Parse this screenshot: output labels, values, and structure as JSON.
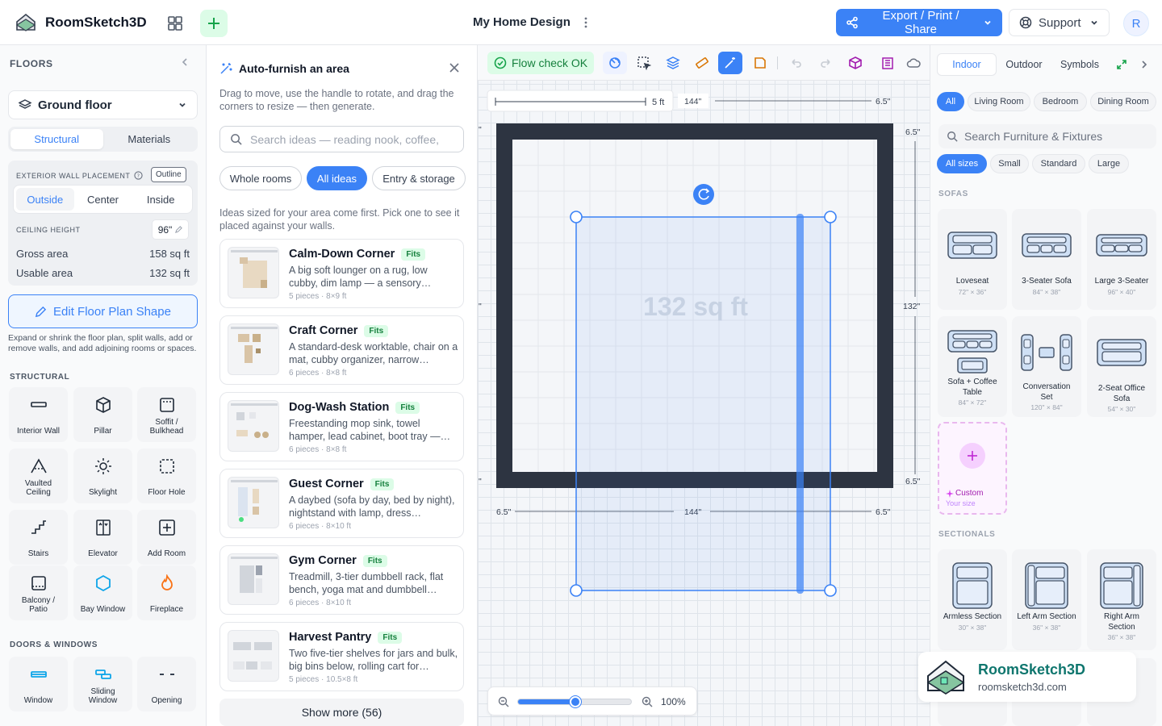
{
  "app": {
    "brand": "RoomSketch3D",
    "doc_title": "My Home Design",
    "avatar_initial": "R"
  },
  "topbar": {
    "export_label": "Export / Print / Share",
    "support_label": "Support"
  },
  "left": {
    "floors_label": "FLOORS",
    "floor_selected": "Ground floor",
    "tabs": [
      "Structural",
      "Materials"
    ],
    "wall_placement_label": "EXTERIOR WALL PLACEMENT",
    "outline_badge": "Outline",
    "placement_options": [
      "Outside",
      "Center",
      "Inside"
    ],
    "ceiling_label": "CEILING HEIGHT",
    "ceiling_value": "96\"",
    "gross_label": "Gross area",
    "gross_value": "158 sq ft",
    "usable_label": "Usable area",
    "usable_value": "132 sq ft",
    "edit_label": "Edit Floor Plan Shape",
    "help_text": "Expand or shrink the floor plan, split walls, add or remove walls, and add adjoining rooms or spaces.",
    "structural_label": "STRUCTURAL",
    "structural_tools": [
      "Interior Wall",
      "Pillar",
      "Soffit / Bulkhead",
      "Vaulted Ceiling",
      "Skylight",
      "Floor Hole",
      "Stairs",
      "Elevator",
      "Add Room",
      "Balcony / Patio",
      "Bay Window",
      "Fireplace"
    ],
    "doors_label": "DOORS & WINDOWS",
    "door_tools": [
      "Window",
      "Sliding Window",
      "Opening"
    ]
  },
  "autofurnish": {
    "title": "Auto-furnish an area",
    "description": "Drag to move, use the handle to rotate, and drag the corners to resize — then generate.",
    "search_placeholder": "Search ideas — reading nook, coffee,",
    "chips": [
      "Whole rooms",
      "All ideas",
      "Entry & storage"
    ],
    "hint": "Ideas sized for your area come first. Pick one to see it placed against your walls.",
    "fits_label": "Fits",
    "cards": [
      {
        "title": "Calm-Down Corner",
        "desc": "A big soft lounger on a rug, low cubby, dim lamp — a sensory…",
        "meta": "5 pieces · 8×9 ft"
      },
      {
        "title": "Craft Corner",
        "desc": "A standard-desk worktable, chair on a mat, cubby organizer, narrow…",
        "meta": "6 pieces · 8×8 ft"
      },
      {
        "title": "Dog-Wash Station",
        "desc": "Freestanding mop sink, towel hamper, lead cabinet, boot tray —…",
        "meta": "6 pieces · 8×8 ft"
      },
      {
        "title": "Guest Corner",
        "desc": "A daybed (sofa by day, bed by night), nightstand with lamp, dress…",
        "meta": "6 pieces · 8×10 ft"
      },
      {
        "title": "Gym Corner",
        "desc": "Treadmill, 3-tier dumbbell rack, flat bench, yoga mat and dumbbell…",
        "meta": "6 pieces · 8×10 ft"
      },
      {
        "title": "Harvest Pantry",
        "desc": "Two five-tier shelves for jars and bulk, big bins below, rolling cart for…",
        "meta": "5 pieces · 10.5×8 ft"
      }
    ],
    "show_more": "Show more (56)"
  },
  "canvas": {
    "flow_label": "Flow check OK",
    "area_label": "132 sq ft",
    "dims": {
      "ruler": "5 ft",
      "top_width": "144\"",
      "bottom_width": "144\"",
      "wall": "6.5\"",
      "height": "132\""
    },
    "zoom_label": "100%",
    "zoom_value": 0.5
  },
  "right": {
    "tabs": [
      "Indoor",
      "Outdoor",
      "Symbols"
    ],
    "rooms": [
      "All",
      "Living Room",
      "Bedroom",
      "Dining Room"
    ],
    "search_placeholder": "Search Furniture & Fixtures",
    "sizes": [
      "All sizes",
      "Small",
      "Standard",
      "Large"
    ],
    "sofas_label": "SOFAS",
    "sofas": [
      {
        "name": "Loveseat",
        "dim": "72\" × 36\""
      },
      {
        "name": "3-Seater Sofa",
        "dim": "84\" × 38\""
      },
      {
        "name": "Large 3-Seater",
        "dim": "96\" × 40\""
      },
      {
        "name": "Sofa + Coffee Table",
        "dim": "84\" × 72\""
      },
      {
        "name": "Conversation Set",
        "dim": "120\" × 84\""
      },
      {
        "name": "2-Seat Office Sofa",
        "dim": "54\" × 30\""
      }
    ],
    "custom_label": "Custom",
    "custom_sub": "Your size",
    "sectionals_label": "SECTIONALS",
    "sectionals": [
      {
        "name": "Armless Section",
        "dim": "30\" × 38\""
      },
      {
        "name": "Left Arm Section",
        "dim": "36\" × 38\""
      },
      {
        "name": "Right Arm Section",
        "dim": "36\" × 38\""
      }
    ]
  },
  "watermark": {
    "brand": "RoomSketch3D",
    "url": "roomsketch3d.com"
  },
  "colors": {
    "accent": "#3b82f6",
    "wall": "#2d3441",
    "success": "#16a34a"
  }
}
